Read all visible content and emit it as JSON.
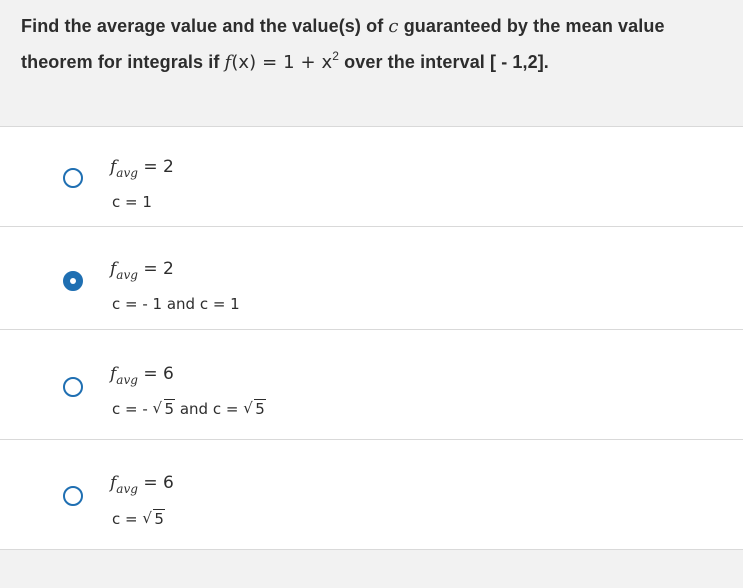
{
  "question": {
    "line1": "Find the average value and the value(s) of c guaranteed by the mean value",
    "line1_before": "Find the average value and the value(s) of ",
    "line1_var": "c",
    "line1_after": " guaranteed by the mean value",
    "line2_before": "theorem for integrals if ",
    "line2_func": "f",
    "line2_paren_x": "(x) = 1 + x",
    "line2_exp": "2",
    "line2_after": " over the interval [ - 1,2]."
  },
  "options": [
    {
      "selected": false,
      "f_letter": "f",
      "f_sub": "avg",
      "f_rest": " = 2",
      "c_text": "c = 1"
    },
    {
      "selected": true,
      "f_letter": "f",
      "f_sub": "avg",
      "f_rest": " = 2",
      "c_text": "c =  - 1 and c = 1"
    },
    {
      "selected": false,
      "f_letter": "f",
      "f_sub": "avg",
      "f_rest": " = 6",
      "c_prefix": "c =  - ",
      "c_sqrt1": "5",
      "c_mid": " and c = ",
      "c_sqrt2": "5"
    },
    {
      "selected": false,
      "f_letter": "f",
      "f_sub": "avg",
      "f_rest": " = 6",
      "c_prefix": "c = ",
      "c_sqrt1": "5"
    }
  ],
  "colors": {
    "accent": "#1f6fb2",
    "background": "#f2f2f2",
    "option_bg": "#ffffff"
  }
}
